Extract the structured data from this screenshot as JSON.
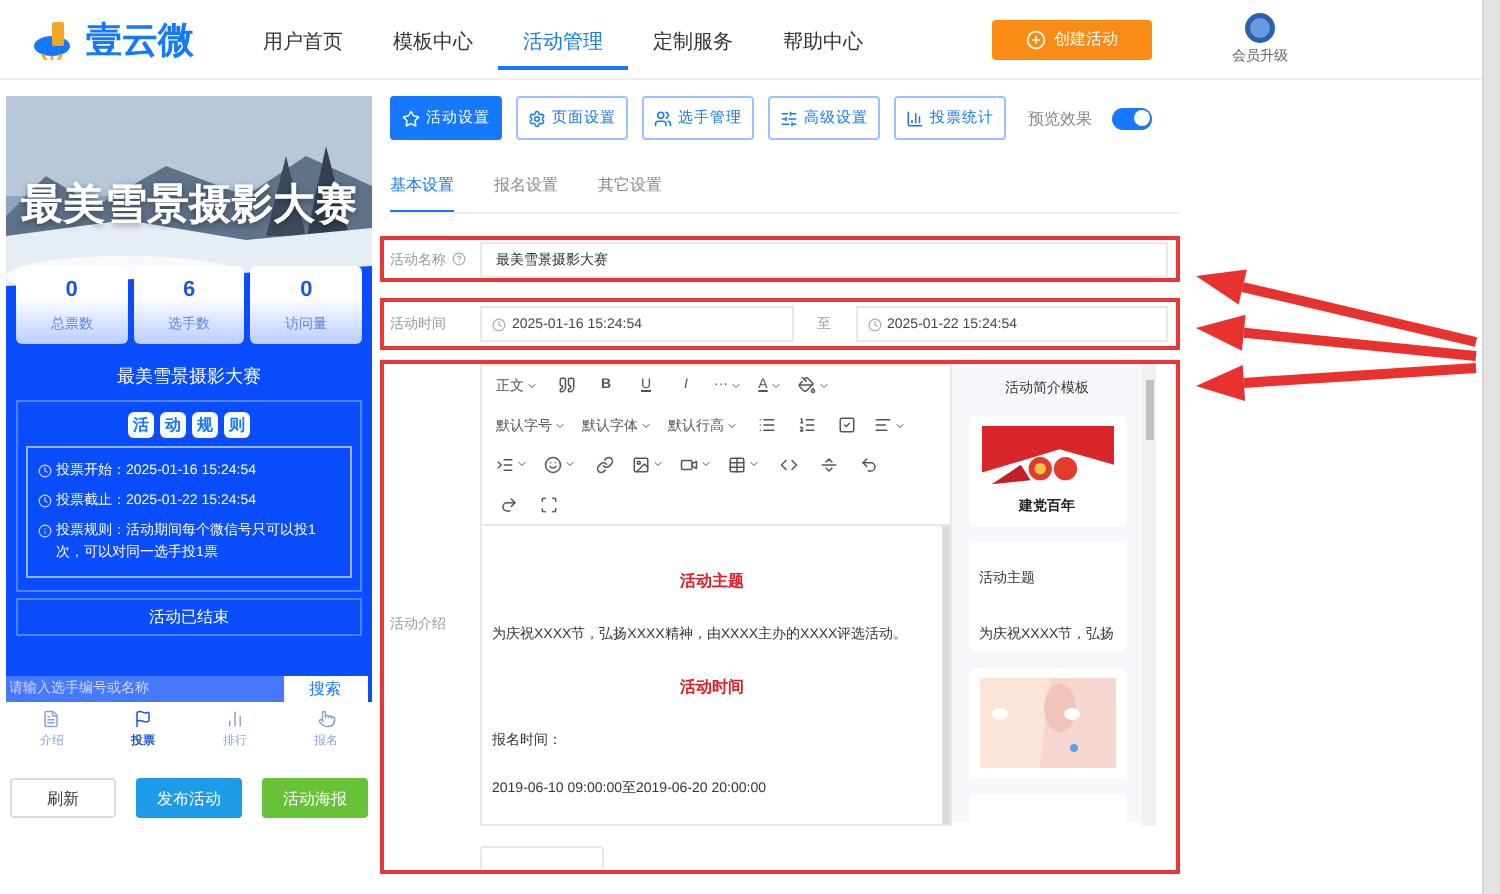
{
  "logo": {
    "text": "壹云微"
  },
  "nav": [
    {
      "label": "用户首页",
      "selected": false
    },
    {
      "label": "模板中心",
      "selected": false
    },
    {
      "label": "活动管理",
      "selected": true
    },
    {
      "label": "定制服务",
      "selected": false
    },
    {
      "label": "帮助中心",
      "selected": false
    }
  ],
  "create_button": "创建活动",
  "vip": {
    "label": "会员升级"
  },
  "preview": {
    "banner_title": "最美雪景摄影大赛",
    "stats": [
      {
        "value": "0",
        "label": "总票数"
      },
      {
        "value": "6",
        "label": "选手数"
      },
      {
        "value": "0",
        "label": "访问量"
      }
    ],
    "title": "最美雪景摄影大赛",
    "rules_heading": [
      "活",
      "动",
      "规",
      "则"
    ],
    "rules": [
      "投票开始：2025-01-16 15:24:54",
      "投票截止：2025-01-22 15:24:54",
      "投票规则：活动期间每个微信号只可以投1次，可以对同一选手投1票"
    ],
    "status": "活动已结束",
    "search": {
      "placeholder": "请输入选手编号或名称",
      "button": "搜索"
    },
    "tabs": [
      {
        "label": "介绍",
        "selected": false
      },
      {
        "label": "投票",
        "selected": true
      },
      {
        "label": "排行",
        "selected": false
      },
      {
        "label": "报名",
        "selected": false
      }
    ],
    "buttons": [
      {
        "label": "刷新",
        "kind": "plain"
      },
      {
        "label": "发布活动",
        "kind": "primary"
      },
      {
        "label": "活动海报",
        "kind": "success"
      }
    ]
  },
  "toolbar": [
    {
      "label": "活动设置",
      "selected": true
    },
    {
      "label": "页面设置",
      "selected": false
    },
    {
      "label": "选手管理",
      "selected": false
    },
    {
      "label": "高级设置",
      "selected": false
    },
    {
      "label": "投票统计",
      "selected": false
    }
  ],
  "preview_toggle": {
    "label": "预览效果",
    "on": true
  },
  "subtabs": [
    {
      "label": "基本设置",
      "selected": true
    },
    {
      "label": "报名设置",
      "selected": false
    },
    {
      "label": "其它设置",
      "selected": false
    }
  ],
  "form": {
    "name": {
      "label": "活动名称",
      "value": "最美雪景摄影大赛"
    },
    "time": {
      "label": "活动时间",
      "start": "2025-01-16 15:24:54",
      "separator": "至",
      "end": "2025-01-22 15:24:54"
    },
    "intro": {
      "label": "活动介绍"
    }
  },
  "editor": {
    "toolbar_rows": [
      [
        {
          "kind": "text",
          "label": "正文",
          "dropdown": true
        },
        {
          "kind": "icon",
          "dropdown": false
        },
        {
          "kind": "bold",
          "label": "B",
          "dropdown": false
        },
        {
          "kind": "underline",
          "label": "U",
          "dropdown": false
        },
        {
          "kind": "italic",
          "label": "I",
          "dropdown": false
        },
        {
          "kind": "text",
          "label": "···",
          "dropdown": true
        },
        {
          "kind": "underline",
          "label": "A",
          "dropdown": true
        },
        {
          "kind": "icon",
          "dropdown": true
        }
      ],
      [
        {
          "kind": "text",
          "label": "默认字号",
          "dropdown": true
        },
        {
          "kind": "text",
          "label": "默认字体",
          "dropdown": true
        },
        {
          "kind": "text",
          "label": "默认行高",
          "dropdown": true
        },
        {
          "kind": "icon",
          "dropdown": false
        },
        {
          "kind": "icon",
          "dropdown": false
        },
        {
          "kind": "icon",
          "dropdown": false
        },
        {
          "kind": "icon",
          "dropdown": true
        }
      ],
      [
        {
          "kind": "icon",
          "dropdown": true
        },
        {
          "kind": "icon",
          "dropdown": true
        },
        {
          "kind": "icon",
          "dropdown": false
        },
        {
          "kind": "icon",
          "dropdown": true
        },
        {
          "kind": "icon",
          "dropdown": true
        },
        {
          "kind": "icon",
          "dropdown": true
        },
        {
          "kind": "icon",
          "dropdown": false
        },
        {
          "kind": "icon",
          "dropdown": false
        },
        {
          "kind": "icon",
          "dropdown": false
        }
      ],
      [
        {
          "kind": "icon",
          "dropdown": false
        },
        {
          "kind": "icon",
          "dropdown": false
        }
      ]
    ],
    "content": [
      {
        "kind": "heading",
        "text": "活动主题"
      },
      {
        "kind": "paragraph",
        "text": "为庆祝XXXX节，弘扬XXXX精神，由XXXX主办的XXXX评选活动。"
      },
      {
        "kind": "heading",
        "text": "活动时间"
      },
      {
        "kind": "paragraph",
        "text": "报名时间："
      },
      {
        "kind": "paragraph",
        "text": "2019-06-10 09:00:00至2019-06-20 20:00:00"
      }
    ]
  },
  "templates": {
    "title": "活动简介模板",
    "cards": [
      {
        "kind": "picture",
        "caption": "建党百年"
      },
      {
        "kind": "text",
        "heading": "活动主题",
        "body": "为庆祝XXXX节，弘扬"
      },
      {
        "kind": "picture"
      },
      {
        "kind": "empty"
      }
    ]
  }
}
